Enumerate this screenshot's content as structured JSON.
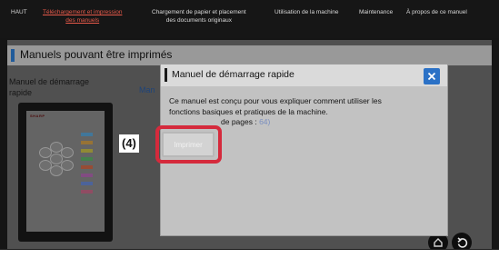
{
  "nav": {
    "items": [
      {
        "label": "HAUT"
      },
      {
        "label_line1": "Téléchargement et impression",
        "label_line2": "des manuels"
      },
      {
        "label_line1": "Chargement de papier et placement",
        "label_line2": "des documents originaux"
      },
      {
        "label": "Utilisation de la machine"
      },
      {
        "label": "Maintenance"
      },
      {
        "label": "À propos de ce manuel"
      }
    ],
    "active_color": "#e85a4a"
  },
  "section": {
    "title": "Manuels pouvant être imprimés",
    "bar_color": "#2d7fd6"
  },
  "manual": {
    "name_line1": "Manuel de démarrage",
    "name_line2": "rapide",
    "partial_label": "Man",
    "cover_brand": "SHARP"
  },
  "dialog": {
    "title": "Manuel de démarrage rapide",
    "body_line1": "Ce manuel est conçu pour vous expliquer comment utiliser les",
    "body_line2": "fonctions basiques et pratiques de la machine.",
    "pages_label": "de pages : ",
    "pages_value": "64)",
    "print_label": "Imprimer",
    "close_color": "#2b71c6"
  },
  "annotation": {
    "step": "(4)",
    "highlight_color": "#d52a3c"
  }
}
